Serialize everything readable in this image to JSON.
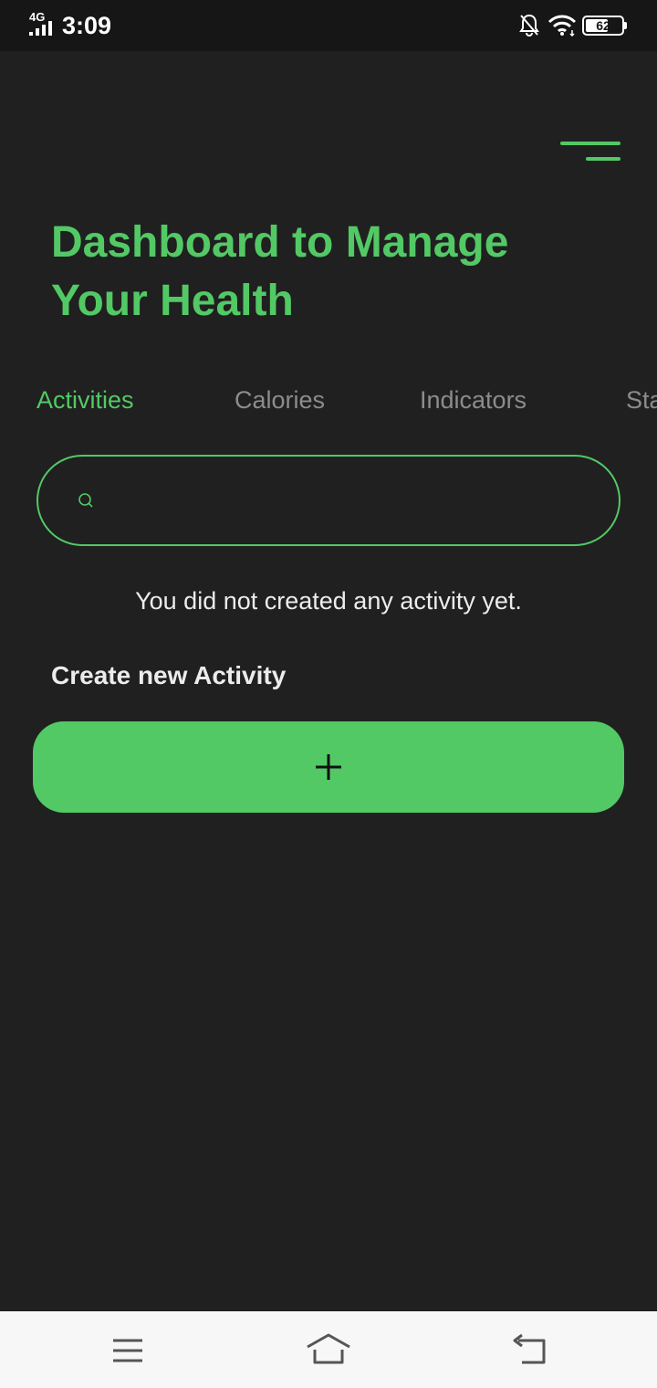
{
  "status_bar": {
    "network": "4G",
    "time": "3:09",
    "battery": "62",
    "battery_level": 0.62,
    "icons": [
      "signal-icon",
      "bell-off-icon",
      "wifi-icon",
      "battery-icon"
    ]
  },
  "header": {
    "menu_icon": "menu-icon",
    "title": "Dashboard to Manage Your Health"
  },
  "tabs": [
    {
      "label": "Activities",
      "active": true
    },
    {
      "label": "Calories",
      "active": false
    },
    {
      "label": "Indicators",
      "active": false
    },
    {
      "label": "Sta",
      "active": false
    }
  ],
  "search": {
    "icon": "search-icon",
    "value": "",
    "placeholder": ""
  },
  "main": {
    "empty_message": "You did not created any activity yet.",
    "create_label": "Create new Activity",
    "add_button_icon": "plus-icon"
  },
  "nav_bar": {
    "icons": [
      "menu-icon",
      "home-icon",
      "back-icon"
    ]
  },
  "colors": {
    "accent": "#52c965",
    "background": "#202020",
    "status_bar": "#161616",
    "nav_bar": "#f7f7f7",
    "inactive_tab": "#8c8c8c"
  }
}
